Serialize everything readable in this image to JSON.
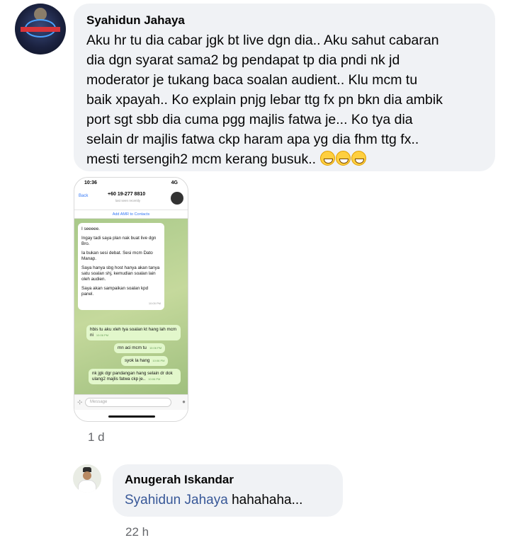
{
  "comment1": {
    "author": "Syahidun Jahaya",
    "lines": [
      "Aku hr tu dia cabar jgk bt live dgn dia.. Aku sahut cabaran",
      "dia dgn syarat sama2 bg pendapat tp dia pndi nk jd",
      "moderator je tukang baca soalan audient.. Klu mcm tu",
      "baik xpayah.. Ko explain pnjg lebar ttg fx pn bkn dia ambik",
      "port sgt sbb dia cuma pgg majlis fatwa je... Ko tya dia",
      "selain dr majlis fatwa ckp haram apa yg dia fhm ttg fx..",
      "mesti tersengih2 mcm kerang busuk.."
    ],
    "emoji": "grinning-squinting-face x3",
    "timestamp": "1 d"
  },
  "screenshot": {
    "status_time": "10:36",
    "status_signal": "4G",
    "back_label": "Back",
    "contact_number": "+60 19-277 8810",
    "last_seen": "last seen recently",
    "add_contact": "Add AMR to Contacts",
    "incoming": [
      "I seeeee.",
      "Ingay tadi saya plan nak buat live dgn Bro.",
      "Ia bukan sesi debat. Sesi mcm Dato Manap.",
      "Saya hanya sbg host hanya akan tanya satu soalan shj, kemudian soalan lain oleh audien.",
      "Saya akan sampaikan soalan kpd panel."
    ],
    "incoming_time": "10:05 PM",
    "outgoing": [
      {
        "text": "hbis tu aku xleh tya soalan kt hang lah mcm ni",
        "time": "10:06 PM"
      },
      {
        "text": "mn aci mcm tu",
        "time": "10:06 PM"
      },
      {
        "text": "syok la hang",
        "time": "10:06 PM"
      },
      {
        "text": "nk jgk dgr pandangan hang selain dr dok ulang2 majlis fatwa ckp je..",
        "time": "10:06 PM"
      }
    ],
    "input_placeholder": "Message"
  },
  "comment2": {
    "author": "Anugerah Iskandar",
    "mention": "Syahidun Jahaya",
    "text": "hahahaha...",
    "timestamp": "22 h"
  }
}
